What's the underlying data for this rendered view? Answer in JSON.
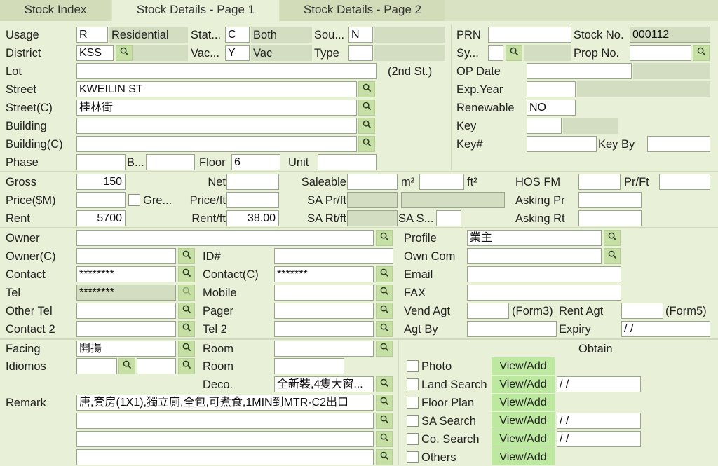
{
  "tabs": [
    "Stock Index",
    "Stock Details - Page 1",
    "Stock Details - Page 2"
  ],
  "labels": {
    "usage": "Usage",
    "district": "District",
    "lot": "Lot",
    "street": "Street",
    "street_c": "Street(C)",
    "building": "Building",
    "building_c": "Building(C)",
    "phase": "Phase",
    "b": "B...",
    "floor": "Floor",
    "unit": "Unit",
    "stat": "Stat...",
    "vac": "Vac...",
    "sou": "Sou...",
    "type": "Type",
    "prn": "PRN",
    "stock_no": "Stock No.",
    "sy": "Sy...",
    "prop_no": "Prop No.",
    "op_date": "OP Date",
    "exp_year": "Exp.Year",
    "renewable": "Renewable",
    "key": "Key",
    "key_hash": "Key#",
    "key_by": "Key By",
    "gross": "Gross",
    "net": "Net",
    "saleable": "Saleable",
    "m2": "m²",
    "ft2": "ft²",
    "hos_fm": "HOS FM",
    "pr_ft": "Pr/Ft",
    "price": "Price($M)",
    "gre": "Gre...",
    "price_ft": "Price/ft",
    "sa_pr_ft": "SA Pr/ft",
    "asking_pr": "Asking Pr",
    "rent": "Rent",
    "rent_ft": "Rent/ft",
    "sa_rt_ft": "SA Rt/ft",
    "sa_s": "SA S...",
    "asking_rt": "Asking Rt",
    "owner": "Owner",
    "owner_c": "Owner(C)",
    "id": "ID#",
    "contact": "Contact",
    "contact_c": "Contact(C)",
    "tel": "Tel",
    "mobile": "Mobile",
    "other_tel": "Other Tel",
    "pager": "Pager",
    "contact2": "Contact 2",
    "tel2": "Tel 2",
    "profile": "Profile",
    "own_com": "Own Com",
    "email": "Email",
    "fax": "FAX",
    "vend_agt": "Vend Agt",
    "form3": "(Form3)",
    "rent_agt": "Rent Agt",
    "form5": "(Form5)",
    "agt_by": "Agt By",
    "expiry": "Expiry",
    "facing": "Facing",
    "room": "Room",
    "idiomos": "Idiomos",
    "room2": "Room",
    "deco": "Deco.",
    "remark": "Remark",
    "obtain": "Obtain"
  },
  "values": {
    "usage": "R",
    "usage_desc": "Residential",
    "stat": "C",
    "stat_desc": "Both",
    "sou": "N",
    "district": "KSS",
    "vac": "Y",
    "vac_desc": "Vac",
    "type": "",
    "street": "KWEILIN ST",
    "street_c": "桂林街",
    "lot_note": "(2nd St.)",
    "floor": "6",
    "stock_no": "000112",
    "renewable": "NO",
    "gross": "150",
    "rent": "5700",
    "rent_ft": "38.00",
    "contact": "********",
    "contact_c": "*******",
    "tel": "********",
    "profile": "業主",
    "expiry": "/ /",
    "facing": "開揚",
    "deco": "全新裝,4隻大窗...",
    "remark": "唐,套房(1X1),獨立廁,全包,可煮食,1MIN到MTR-C2出口"
  },
  "obtain_items": [
    {
      "label": "Photo",
      "button": "View/Add",
      "date": ""
    },
    {
      "label": "Land Search",
      "button": "View/Add",
      "date": "/ /"
    },
    {
      "label": "Floor Plan",
      "button": "View/Add",
      "date": ""
    },
    {
      "label": "SA Search",
      "button": "View/Add",
      "date": "/ /"
    },
    {
      "label": "Co. Search",
      "button": "View/Add",
      "date": "/ /"
    },
    {
      "label": "Others",
      "button": "View/Add",
      "date": ""
    }
  ],
  "icons": {
    "search": "magnifier-icon"
  },
  "colors": {
    "background": "#e9f0d8",
    "search_button": "#c5dfa4",
    "view_button": "#bde8a0",
    "readonly_field": "#d3ddc2"
  }
}
